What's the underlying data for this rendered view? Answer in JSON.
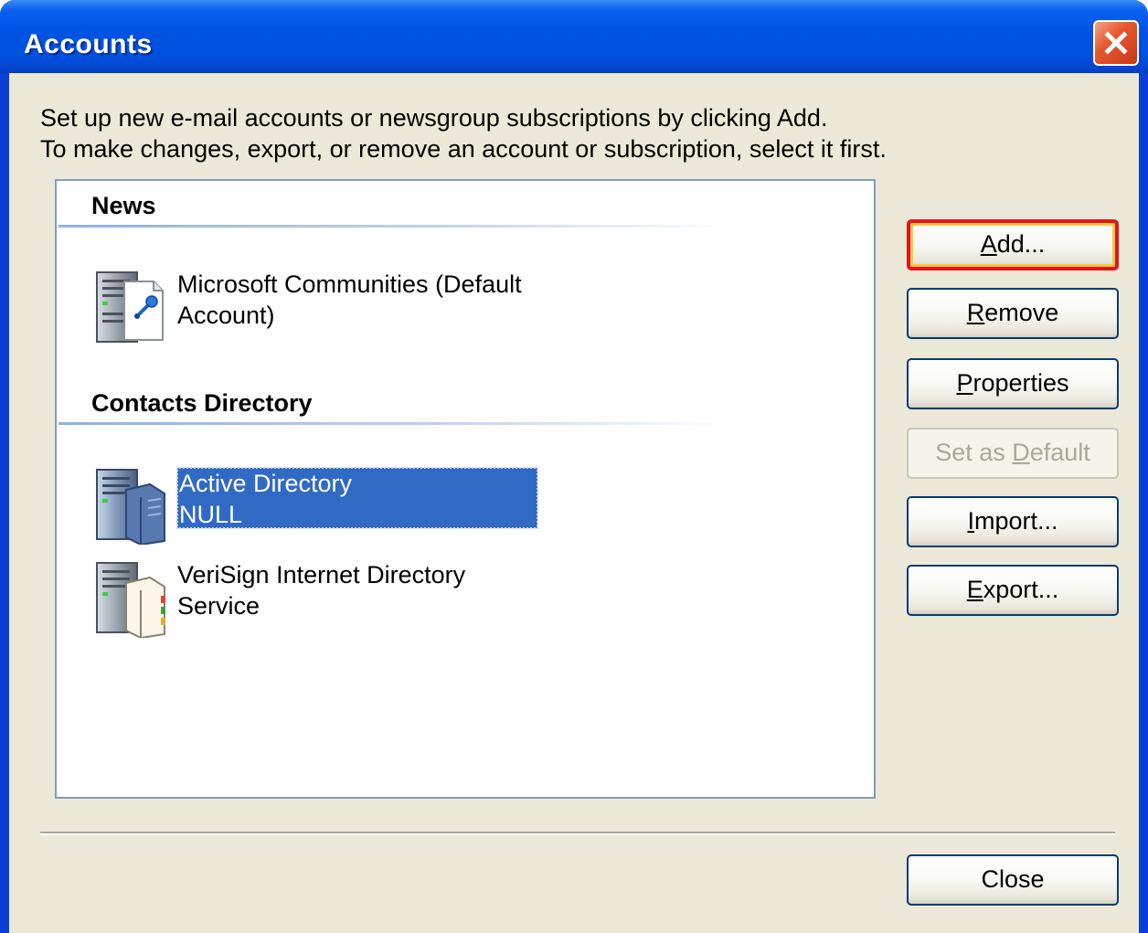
{
  "window": {
    "title": "Accounts",
    "close_glyph": "close-icon"
  },
  "intro": {
    "line1": "Set up new e-mail accounts or newsgroup subscriptions by clicking Add.",
    "line2": "To make changes, export, or remove an account or subscription, select it first."
  },
  "accounts": {
    "groups": [
      {
        "heading": "News",
        "items": [
          {
            "line1": "Microsoft Communities (Default",
            "line2": "Account)",
            "icon": "news-server-icon",
            "selected": false
          }
        ]
      },
      {
        "heading": "Contacts Directory",
        "items": [
          {
            "line1": "Active Directory",
            "line2": "NULL",
            "icon": "directory-server-icon",
            "selected": true
          },
          {
            "line1": "VeriSign Internet Directory",
            "line2": "Service",
            "icon": "directory-server-icon",
            "selected": false
          }
        ]
      }
    ]
  },
  "buttons": {
    "add": {
      "pre": "",
      "key": "A",
      "post": "dd...",
      "state": "focused"
    },
    "remove": {
      "pre": "",
      "key": "R",
      "post": "emove",
      "state": "normal"
    },
    "properties": {
      "pre": "",
      "key": "P",
      "post": "roperties",
      "state": "normal"
    },
    "set_default": {
      "pre": "Set as ",
      "key": "D",
      "post": "efault",
      "state": "disabled"
    },
    "import": {
      "pre": "",
      "key": "I",
      "post": "mport...",
      "state": "normal"
    },
    "export": {
      "pre": "",
      "key": "E",
      "post": "xport...",
      "state": "normal"
    },
    "close": {
      "label": "Close",
      "state": "normal"
    }
  },
  "colors": {
    "titlebar": "#0054e3",
    "selection": "#316ac5",
    "focus_ring": "#e8121b",
    "dialog_bg": "#ece9d8"
  }
}
